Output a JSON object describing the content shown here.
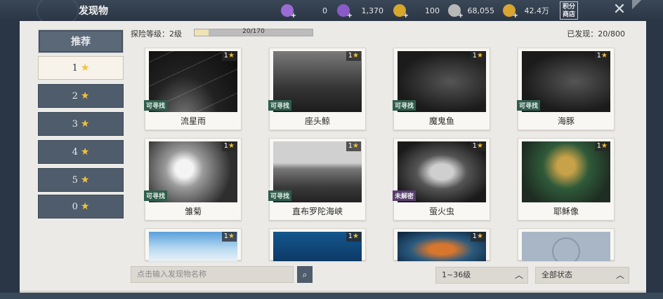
{
  "header": {
    "title": "发现物",
    "resources": [
      {
        "icon": "purple-gem-icon",
        "value": "0",
        "color": "#9b6bd6"
      },
      {
        "icon": "purple-crystal-icon",
        "value": "1,370",
        "color": "#8a5bc8"
      },
      {
        "icon": "gold-coin-icon",
        "value": "100",
        "color": "#d7a72c"
      },
      {
        "icon": "silver-coin-icon",
        "value": "68,055",
        "color": "#b8b8b8"
      },
      {
        "icon": "gold-ingot-icon",
        "value": "42.4万",
        "color": "#d9a531"
      }
    ],
    "shop_label": "积分商店",
    "shop_line1": "积分",
    "shop_line2": "商店",
    "close_glyph": "✕"
  },
  "sidebar": {
    "items": [
      {
        "label": "推荐",
        "stars": false
      },
      {
        "label": "1",
        "stars": true
      },
      {
        "label": "2",
        "stars": true
      },
      {
        "label": "3",
        "stars": true
      },
      {
        "label": "4",
        "stars": true
      },
      {
        "label": "5",
        "stars": true
      },
      {
        "label": "0",
        "stars": true
      }
    ],
    "active_index": 1
  },
  "stats": {
    "level_label": "探险等级：2级",
    "level_progress_text": "20/170",
    "level_progress": 0.118,
    "found_label": "已发现：20/800"
  },
  "cards": [
    {
      "name": "流星雨",
      "rarity": "1",
      "tag": "可寻找",
      "tag_style": "green",
      "art": "night"
    },
    {
      "name": "座头鲸",
      "rarity": "1",
      "tag": "可寻找",
      "tag_style": "green",
      "art": "sea"
    },
    {
      "name": "魔鬼鱼",
      "rarity": "1",
      "tag": "可寻找",
      "tag_style": "green",
      "art": "dark"
    },
    {
      "name": "海豚",
      "rarity": "1",
      "tag": "可寻找",
      "tag_style": "green",
      "art": "dark"
    },
    {
      "name": "雏菊",
      "rarity": "1",
      "tag": "可寻找",
      "tag_style": "green",
      "art": "flower"
    },
    {
      "name": "直布罗陀海峡",
      "rarity": "1",
      "tag": "可寻找",
      "tag_style": "green",
      "art": "land"
    },
    {
      "name": "萤火虫",
      "rarity": "1",
      "tag": "未解密",
      "tag_style": "purple",
      "art": "beetle"
    },
    {
      "name": "耶稣像",
      "rarity": "1",
      "tag": "",
      "tag_style": "",
      "art": "icon-art"
    },
    {
      "name": "",
      "rarity": "1",
      "tag": "",
      "tag_style": "",
      "art": "sky"
    },
    {
      "name": "",
      "rarity": "1",
      "tag": "",
      "tag_style": "",
      "art": "ocean"
    },
    {
      "name": "",
      "rarity": "1",
      "tag": "",
      "tag_style": "",
      "art": "fish"
    },
    {
      "name": "",
      "rarity": "",
      "tag": "",
      "tag_style": "",
      "art": "locked"
    }
  ],
  "controls": {
    "search_placeholder": "点击输入发现物名称",
    "level_filter": "1~36级",
    "status_filter": "全部状态"
  }
}
